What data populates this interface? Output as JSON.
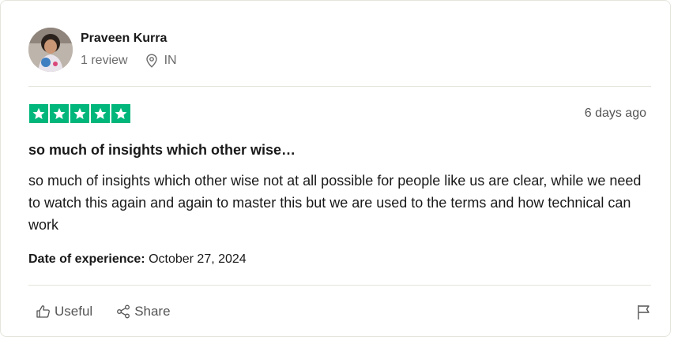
{
  "reviewer": {
    "name": "Praveen Kurra",
    "review_count": "1 review",
    "country": "IN",
    "avatar_icon": "user-avatar-photo"
  },
  "review": {
    "rating": 5,
    "rating_max": 5,
    "star_color": "#00b67a",
    "posted": "6 days ago",
    "title": "so much of insights which other wise…",
    "body": "so much of insights which other wise not at all possible for people like us are clear, while we need to watch this again and again to master this but we are used to the terms and how technical can work",
    "experience_label": "Date of experience:",
    "experience_date": "October 27, 2024"
  },
  "actions": {
    "useful_label": "Useful",
    "share_label": "Share",
    "useful_icon": "thumbs-up-icon",
    "share_icon": "share-icon",
    "report_icon": "flag-icon"
  }
}
